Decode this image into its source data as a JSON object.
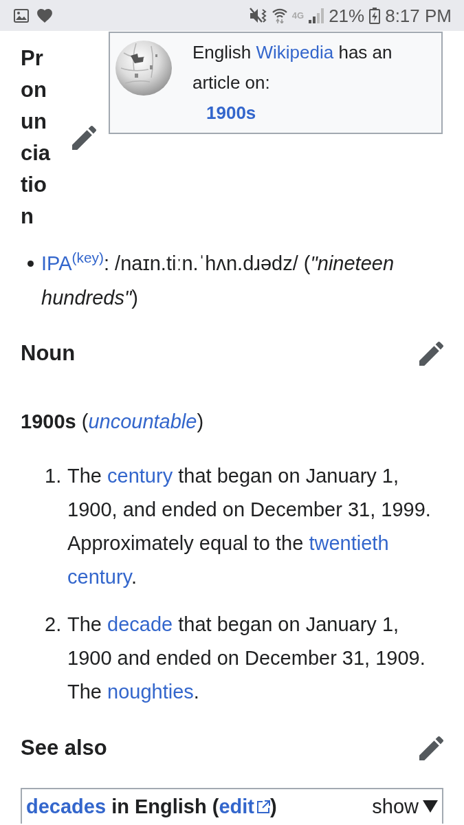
{
  "status_bar": {
    "network_type": "4G",
    "battery": "21%",
    "time": "8:17 PM"
  },
  "pronunciation": {
    "heading": "Pronunciation",
    "wiki_box": {
      "parts": [
        {
          "kind": "plain",
          "text": "English "
        },
        {
          "kind": "link",
          "text": "Wikipedia"
        },
        {
          "kind": "plain",
          "text": " has an article on:"
        }
      ],
      "article_link": "1900s"
    },
    "bullets": [
      {
        "parts": [
          {
            "kind": "link",
            "text": "IPA"
          },
          {
            "kind": "sup_link",
            "text": "(key)"
          },
          {
            "kind": "plain",
            "text": ": /naɪn.tiːn.ˈhʌn.dɹədz/ ("
          },
          {
            "kind": "italic",
            "text": "\"nineteen hundreds\""
          },
          {
            "kind": "plain",
            "text": ")"
          }
        ]
      }
    ]
  },
  "noun": {
    "heading": "Noun",
    "headword": [
      {
        "kind": "bold",
        "text": "1900s"
      },
      {
        "kind": "plain",
        "text": " ("
      },
      {
        "kind": "italic_link",
        "text": "uncountable"
      },
      {
        "kind": "plain",
        "text": ")"
      }
    ],
    "definitions": [
      {
        "number": "1.",
        "parts": [
          {
            "kind": "plain",
            "text": "The "
          },
          {
            "kind": "link",
            "text": "century"
          },
          {
            "kind": "plain",
            "text": " that began on January 1, 1900, and ended on December 31, 1999. Approximately equal to the "
          },
          {
            "kind": "link",
            "text": "twentieth"
          },
          {
            "kind": "space"
          },
          {
            "kind": "link",
            "text": "century"
          },
          {
            "kind": "plain",
            "text": "."
          }
        ]
      },
      {
        "number": "2.",
        "parts": [
          {
            "kind": "plain",
            "text": "The "
          },
          {
            "kind": "link",
            "text": "decade"
          },
          {
            "kind": "plain",
            "text": " that began on January 1, 1900 and ended on December 31, 1909. The "
          },
          {
            "kind": "link",
            "text": "noughties"
          },
          {
            "kind": "plain",
            "text": "."
          }
        ]
      }
    ]
  },
  "see_also": {
    "heading": "See also",
    "navbox": {
      "parts": [
        {
          "kind": "link",
          "text": "decades"
        },
        {
          "kind": "plain",
          "text": " in English ("
        },
        {
          "kind": "external_link",
          "text": "edit"
        },
        {
          "kind": "plain",
          "text": ")"
        }
      ],
      "toggle": "show"
    }
  }
}
